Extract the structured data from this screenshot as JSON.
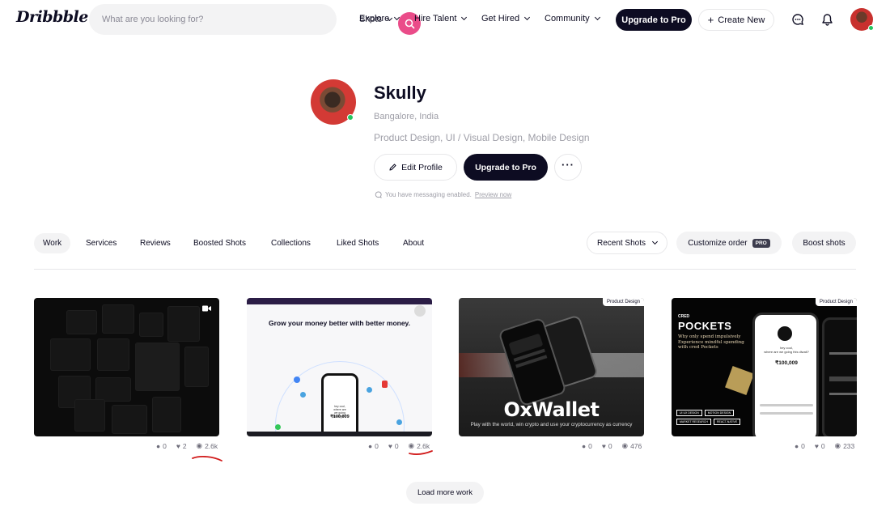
{
  "header": {
    "logo": "Dribbble",
    "search_placeholder": "What are you looking for?",
    "search_scope": "Shots",
    "nav": [
      "Explore",
      "Hire Talent",
      "Get Hired",
      "Community"
    ],
    "upgrade_label": "Upgrade to Pro",
    "create_label": "Create New",
    "accent": "#ea4c89"
  },
  "profile": {
    "name": "Skully",
    "location": "Bangalore, India",
    "skills": "Product Design, UI / Visual Design, Mobile Design",
    "edit_label": "Edit Profile",
    "upgrade_label": "Upgrade to Pro",
    "messaging_note": "You have messaging enabled.",
    "preview_link": "Preview now"
  },
  "tabs": {
    "items": [
      "Work",
      "Services",
      "Reviews",
      "Boosted Shots",
      "Collections",
      "Liked Shots",
      "About"
    ],
    "active": "Work",
    "sort_label": "Recent Shots",
    "customize_label": "Customize order",
    "pro_badge": "PRO",
    "boost_label": "Boost shots"
  },
  "shots": [
    {
      "comments": "0",
      "likes": "2",
      "views": "2.6k",
      "tag": "",
      "has_video_icon": true
    },
    {
      "comments": "0",
      "likes": "0",
      "views": "2.6k",
      "tag": "",
      "headline": "Grow your money better with better money.",
      "phone_amount": "₹100,009"
    },
    {
      "comments": "0",
      "likes": "0",
      "views": "476",
      "tag": "Product Design",
      "brand": "OxWallet",
      "sub": "Play with the world, win crypto and use your cryptocurrency as currency"
    },
    {
      "comments": "0",
      "likes": "0",
      "views": "233",
      "tag": "Product Design",
      "cred": "CRED",
      "pockets": "POCKETS",
      "tagline": "Why only spend impulsively Experience mindful spending with cred Pockets",
      "phone_amount": "₹100,009",
      "chips": [
        "UI UX DESIGN",
        "MOTION DESIGN",
        "MARKET RESEARCH",
        "REACT-NATIVE"
      ]
    }
  ],
  "load_more_label": "Load more work"
}
